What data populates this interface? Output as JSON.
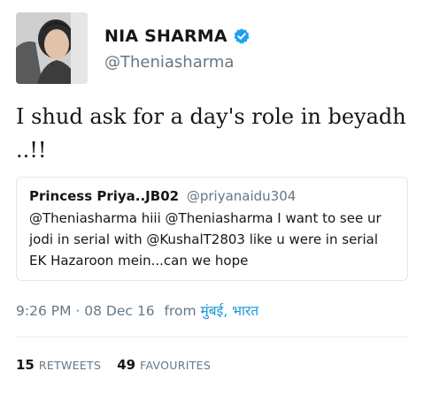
{
  "author": {
    "display_name": "NIA SHARMA",
    "handle": "@Theniasharma",
    "verified": true
  },
  "tweet": {
    "text": "I shud ask for a day's role in beyadh ..!!"
  },
  "quoted_tweet": {
    "display_name": "Princess Priya..JB02",
    "handle": "@priyanaidu304",
    "text": "@Theniasharma hiii @Theniasharma  I want to see ur jodi in serial with @KushalT2803  like u were in serial EK Hazaroon mein...can we hope"
  },
  "meta": {
    "time": "9:26 PM",
    "date": "08 Dec 16",
    "from_label": "from",
    "location": "मुंबई, भारत"
  },
  "stats": {
    "retweets_count": "15",
    "retweets_label": "RETWEETS",
    "favourites_count": "49",
    "favourites_label": "FAVOURITES"
  },
  "colors": {
    "text": "#14171a",
    "secondary": "#657786",
    "link": "#1b95e0",
    "verified_badge": "#1da1f2",
    "border": "#e1e8ed"
  },
  "icons": {
    "verified": "verified-badge-icon"
  }
}
